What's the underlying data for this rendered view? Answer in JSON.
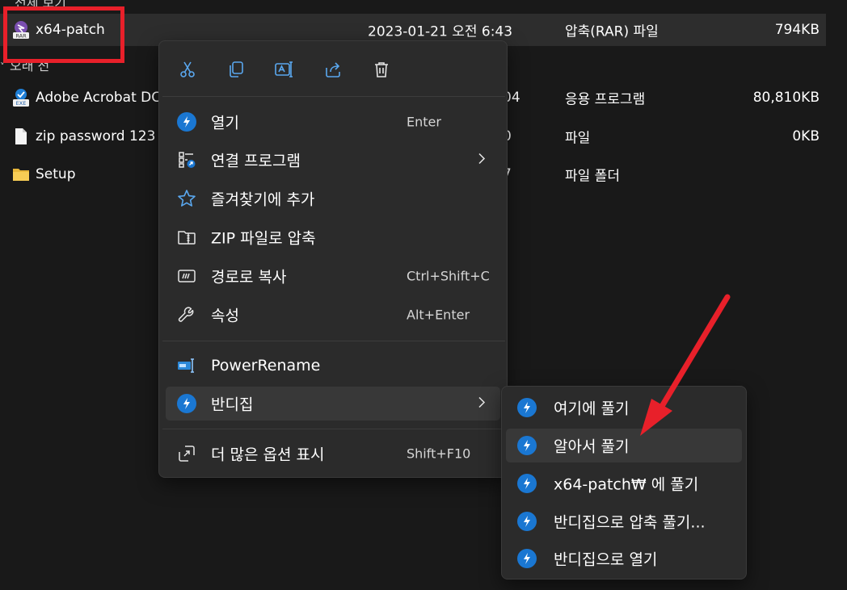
{
  "file_list": {
    "group_top": "전체 보기",
    "group_older": "오래 전",
    "rows": [
      {
        "name": "x64-patch",
        "date": "2023-01-21 오전 6:43",
        "type": "압축(RAR) 파일",
        "size": "794KB",
        "icon": "rar-file-icon"
      },
      {
        "name": "Adobe Acrobat DC",
        "date": "04",
        "type": "응용 프로그램",
        "size": "80,810KB",
        "icon": "exe-file-icon"
      },
      {
        "name": "zip password 123",
        "date": "0",
        "type": "파일",
        "size": "0KB",
        "icon": "blank-file-icon"
      },
      {
        "name": "Setup",
        "date": "7",
        "type": "파일 폴더",
        "size": "",
        "icon": "folder-icon"
      }
    ]
  },
  "context_menu": {
    "toolbar": [
      "cut-icon",
      "copy-icon",
      "rename-icon",
      "share-icon",
      "delete-icon"
    ],
    "items": [
      {
        "label": "열기",
        "shortcut": "Enter",
        "icon": "bandizip-icon"
      },
      {
        "label": "연결 프로그램",
        "shortcut": "",
        "icon": "open-with-icon",
        "submenu": true
      },
      {
        "label": "즐겨찾기에 추가",
        "shortcut": "",
        "icon": "star-icon"
      },
      {
        "label": "ZIP 파일로 압축",
        "shortcut": "",
        "icon": "zip-folder-icon"
      },
      {
        "label": "경로로 복사",
        "shortcut": "Ctrl+Shift+C",
        "icon": "copy-path-icon"
      },
      {
        "label": "속성",
        "shortcut": "Alt+Enter",
        "icon": "wrench-icon"
      },
      {
        "label": "PowerRename",
        "shortcut": "",
        "icon": "powerrename-icon"
      },
      {
        "label": "반디집",
        "shortcut": "",
        "icon": "bandizip-icon",
        "submenu": true
      },
      {
        "label": "더 많은 옵션 표시",
        "shortcut": "Shift+F10",
        "icon": "more-options-icon"
      }
    ]
  },
  "submenu": {
    "items": [
      {
        "label": "여기에 풀기"
      },
      {
        "label": "알아서 풀기"
      },
      {
        "label": "x64-patch₩ 에 풀기"
      },
      {
        "label": "반디집으로 압축 풀기..."
      },
      {
        "label": "반디집으로 열기"
      }
    ]
  },
  "colors": {
    "background": "#191919",
    "menu_bg": "#2b2b2b",
    "hover_bg": "#383838",
    "accent_blue": "#1a77d2",
    "annotation_red": "#e8202a"
  }
}
